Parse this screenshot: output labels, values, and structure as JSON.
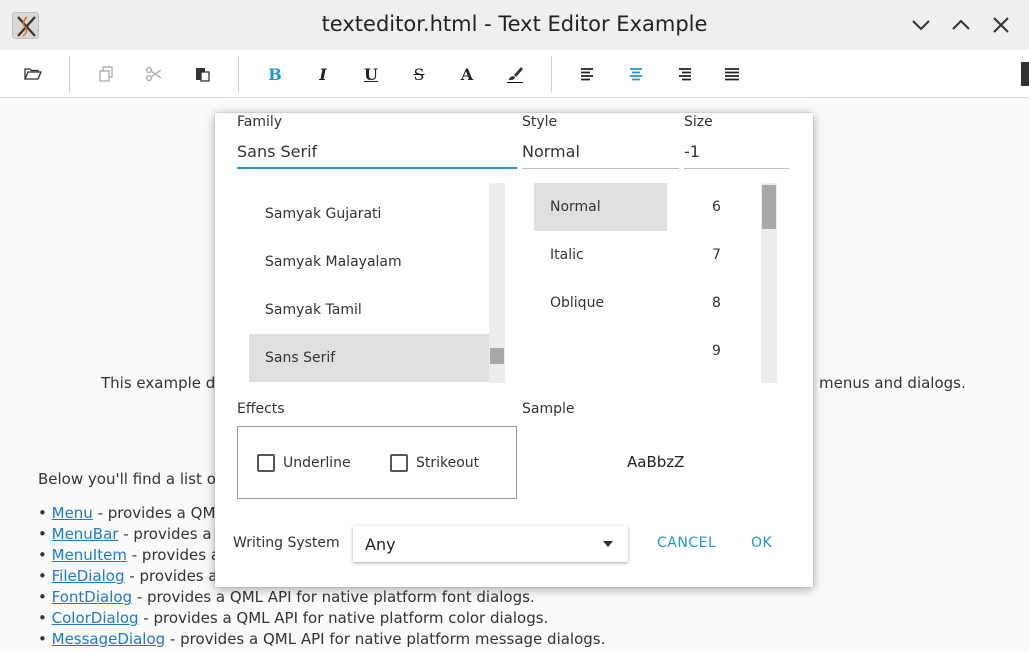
{
  "window": {
    "title": "texteditor.html - Text Editor Example"
  },
  "toolbar": {
    "bold": "B",
    "italic": "I",
    "underline": "U",
    "strikeout": "S",
    "text_color": "A"
  },
  "document": {
    "intro_left": "This example de",
    "intro_right": "menus and dialogs.",
    "list_intro": "Below you'll find a list of",
    "items": [
      {
        "link": "Menu",
        "text": " - provides a QML"
      },
      {
        "link": "MenuBar",
        "text": " - provides a Q"
      },
      {
        "link": "MenuItem",
        "text": " - provides a Q"
      },
      {
        "link": "FileDialog",
        "text": " - provides a Q"
      },
      {
        "link": "FontDialog",
        "text": " - provides a QML API for native platform font dialogs."
      },
      {
        "link": "ColorDialog",
        "text": " - provides a QML API for native platform color dialogs."
      },
      {
        "link": "MessageDialog",
        "text": " - provides a QML API for native platform message dialogs."
      }
    ]
  },
  "dialog": {
    "family_label": "Family",
    "family_value": "Sans Serif",
    "style_label": "Style",
    "style_value": "Normal",
    "size_label": "Size",
    "size_value": "-1",
    "families": [
      "Samyak Gujarati",
      "Samyak Malayalam",
      "Samyak Tamil",
      "Sans Serif"
    ],
    "styles": [
      "Normal",
      "Italic",
      "Oblique"
    ],
    "sizes": [
      "6",
      "7",
      "8",
      "9"
    ],
    "effects_label": "Effects",
    "underline_label": "Underline",
    "strikeout_label": "Strikeout",
    "sample_label": "Sample",
    "sample_text": "AaBbzZ",
    "writing_system_label": "Writing System",
    "writing_system_value": "Any",
    "cancel_label": "CANCEL",
    "ok_label": "OK"
  },
  "colors": {
    "accent": "#2196d3",
    "link": "#1d7ad1",
    "selection": "#e0e0e0"
  }
}
